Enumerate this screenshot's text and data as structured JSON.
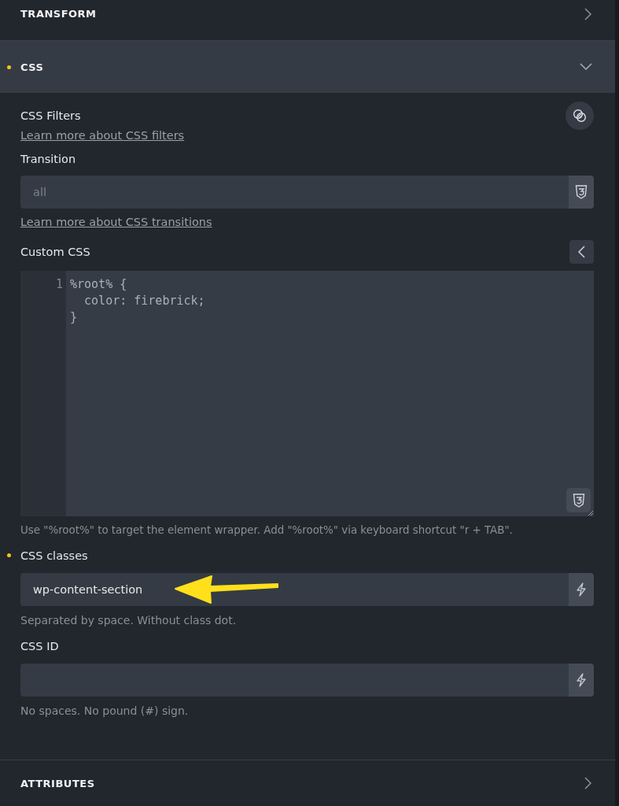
{
  "sections": [
    {
      "title": "TRANSFORM",
      "expanded": false,
      "modified": false
    },
    {
      "title": "CSS",
      "expanded": true,
      "modified": true
    },
    {
      "title": "ATTRIBUTES",
      "expanded": false,
      "modified": false
    }
  ],
  "css": {
    "filters": {
      "label": "CSS Filters",
      "link": "Learn more about CSS filters"
    },
    "transition": {
      "label": "Transition",
      "placeholder": "all",
      "link": "Learn more about CSS transitions"
    },
    "custom_css": {
      "label": "Custom CSS",
      "line_numbers": [
        "1"
      ],
      "lines": [
        "%root% {",
        "  color: firebrick;",
        "}"
      ],
      "hint": "Use \"%root%\" to target the element wrapper. Add \"%root%\" via keyboard shortcut \"r + TAB\"."
    },
    "classes": {
      "label": "CSS classes",
      "modified": true,
      "value": "wp-content-section",
      "hint": "Separated by space. Without class dot."
    },
    "id": {
      "label": "CSS ID",
      "modified": false,
      "hint": "No spaces. No pound (#) sign."
    }
  }
}
